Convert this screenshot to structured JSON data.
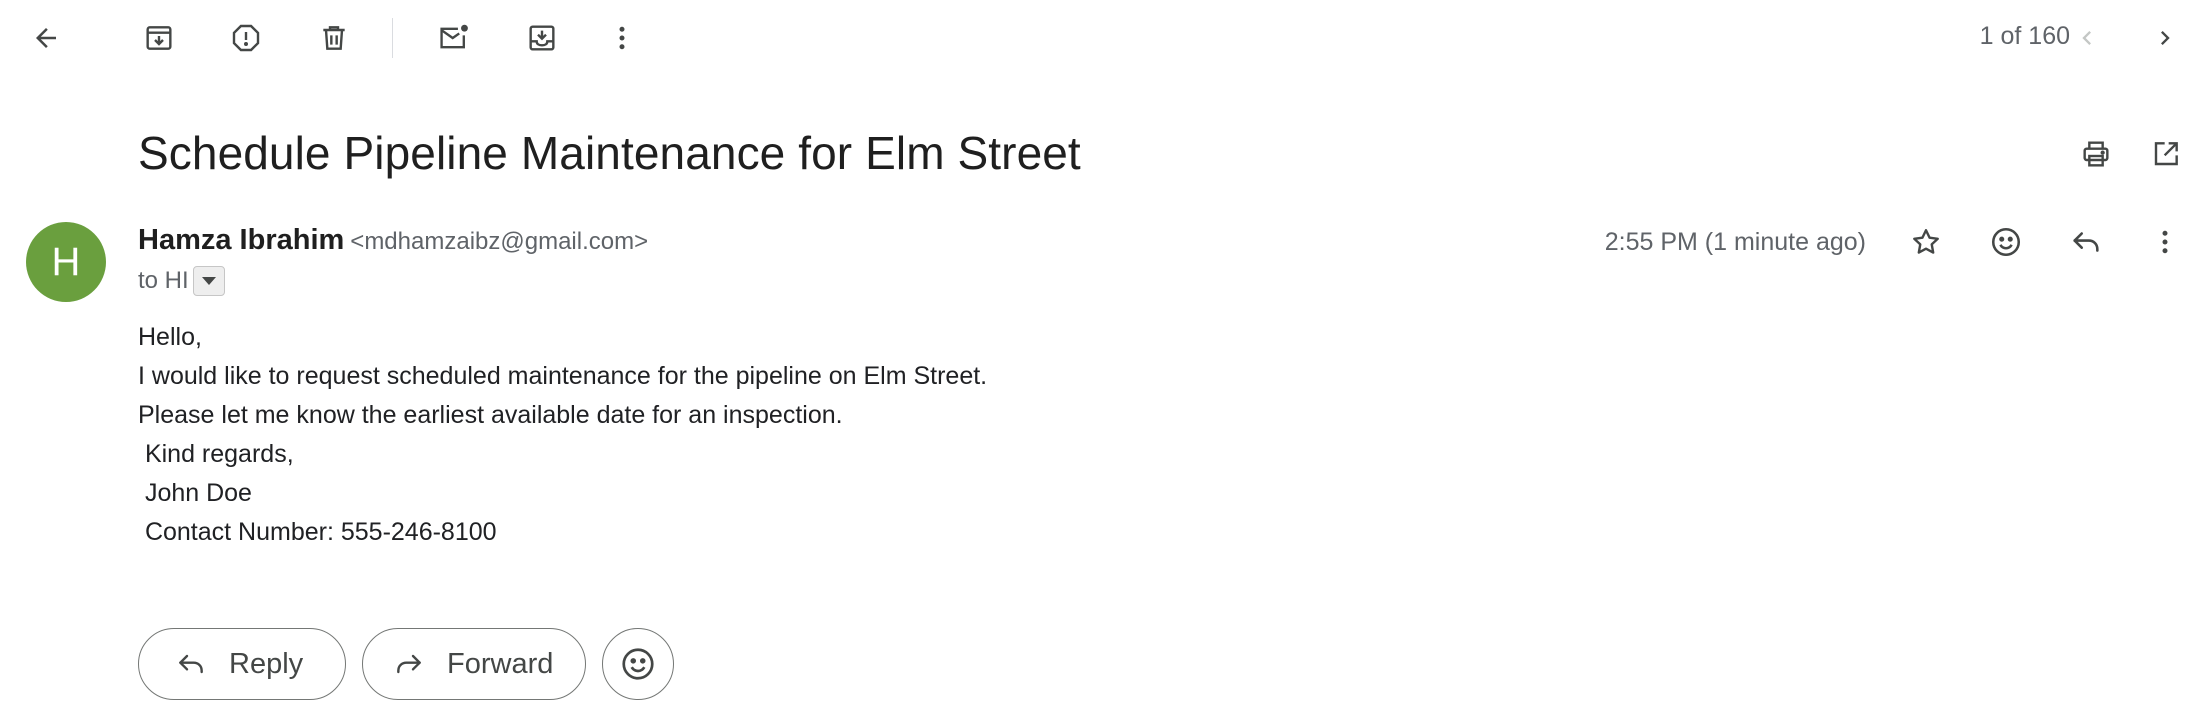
{
  "toolbar": {
    "back_icon": "arrow-left-icon",
    "archive_icon": "archive-icon",
    "report_spam_icon": "report-icon",
    "delete_icon": "trash-icon",
    "mark_unread_icon": "mark-unread-icon",
    "move_to_icon": "move-to-inbox-icon",
    "more_icon": "more-vertical-icon",
    "pager_text": "1 of 160",
    "older_icon": "chevron-left-icon",
    "newer_icon": "chevron-right-icon"
  },
  "email": {
    "subject": "Schedule Pipeline Maintenance for Elm Street",
    "sender_initial": "H",
    "sender_name": "Hamza Ibrahim",
    "sender_email": "<mdhamzaibz@gmail.com>",
    "to_line": "to HI",
    "timestamp": "2:55 PM (1 minute ago)",
    "body_lines": [
      "Hello,",
      "I would like to request scheduled maintenance for the pipeline on Elm Street.",
      "Please let me know the earliest available date for an inspection.",
      " Kind regards,",
      " John Doe",
      " Contact Number: 555-246-8100"
    ]
  },
  "actions": {
    "reply_label": "Reply",
    "forward_label": "Forward"
  },
  "colors": {
    "avatar_bg": "#6a9f3e",
    "icon_gray": "#444746",
    "muted_text": "#5f6368"
  }
}
